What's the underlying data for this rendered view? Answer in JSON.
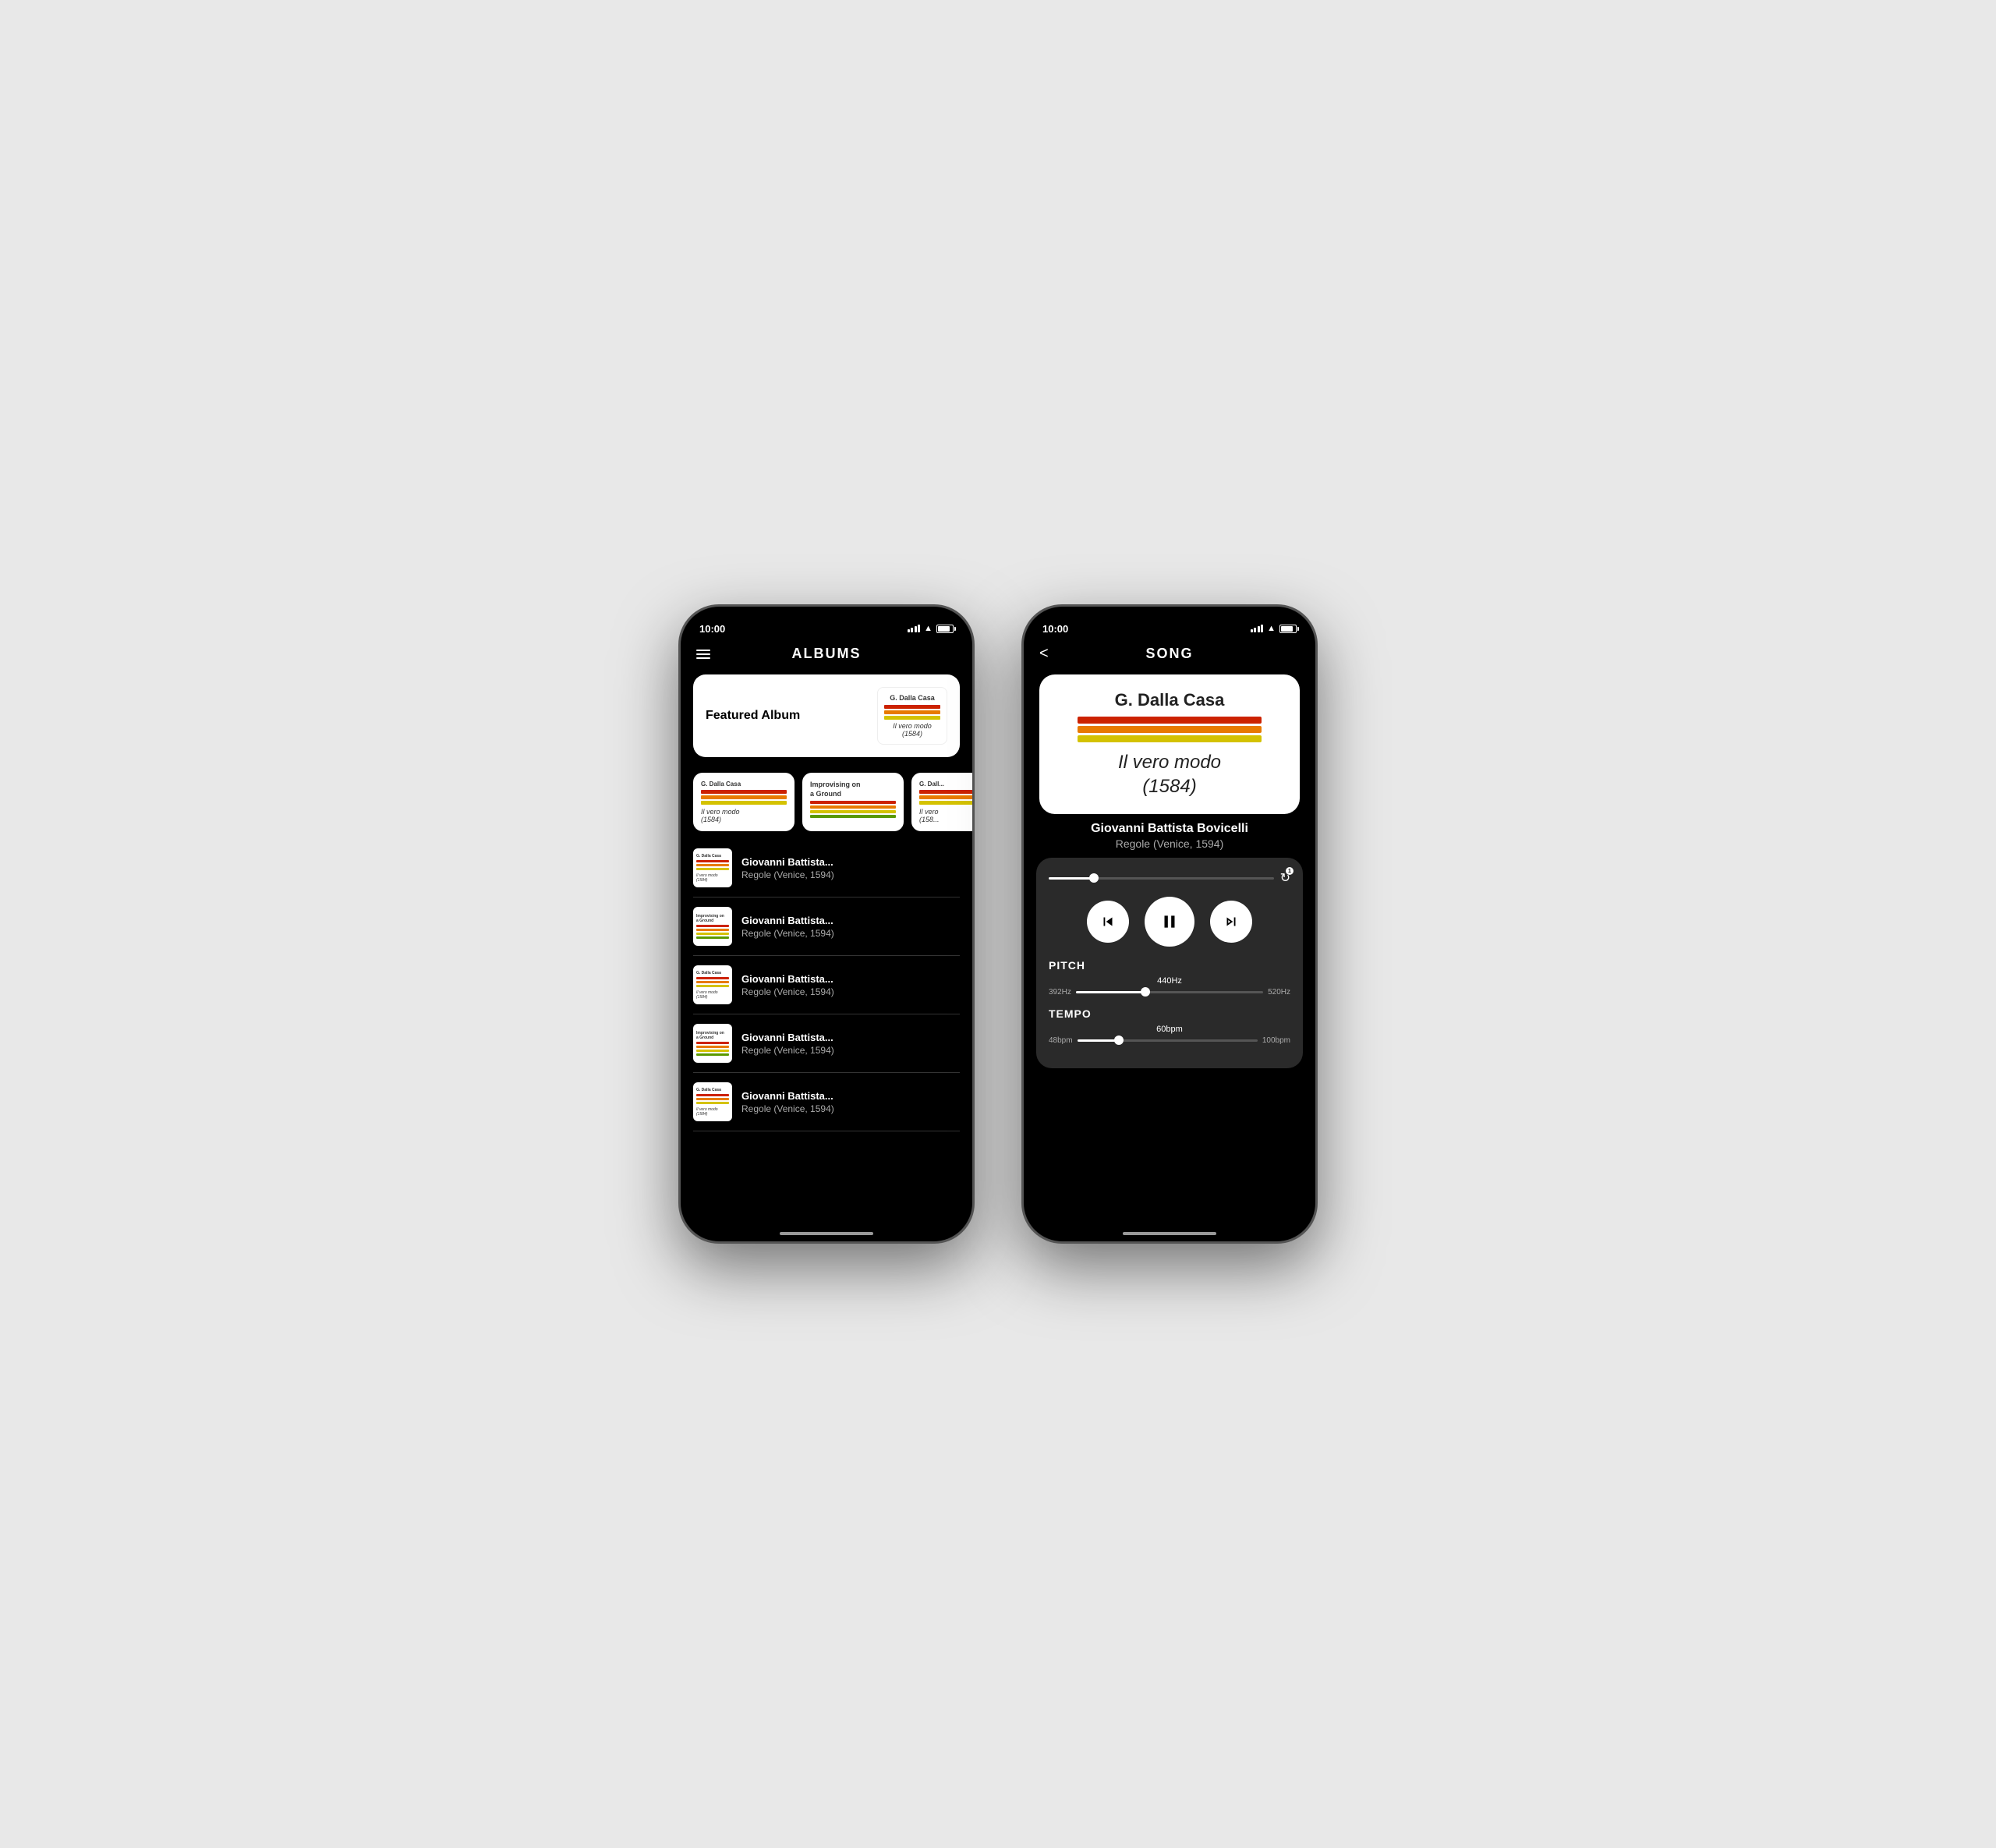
{
  "left_phone": {
    "status_bar": {
      "time": "10:00"
    },
    "nav": {
      "title": "ALBUMS"
    },
    "featured": {
      "label": "Featured Album",
      "album_author": "G. Dalla Casa",
      "album_title_italic": "Il vero modo",
      "album_year": "(1584)"
    },
    "horizontal_albums": [
      {
        "author": "G. Dalla Casa",
        "title": "Il vero modo",
        "year": "(1584)",
        "type": "dalla_casa"
      },
      {
        "author": "Improvising on\na Ground",
        "title": "",
        "year": "",
        "type": "improvising"
      },
      {
        "author": "G. Dall...",
        "title": "Il vero",
        "year": "(158...",
        "type": "dalla_casa_cropped"
      }
    ],
    "list_items": [
      {
        "artist": "Giovanni Battista Bovicelli",
        "album": "Regole (Venice, 1594)",
        "thumb_type": "dalla_casa",
        "thumb_author": "G. Dalla Casa",
        "thumb_title": "Il vero modo\n(1584)"
      },
      {
        "artist": "Giovanni Battista Bovicelli",
        "album": "Regole (Venice, 1594)",
        "thumb_type": "improvising",
        "thumb_author": "Improvising on\na Ground",
        "thumb_title": ""
      },
      {
        "artist": "Giovanni Battista Bovicelli",
        "album": "Regole (Venice, 1594)",
        "thumb_type": "dalla_casa",
        "thumb_author": "G. Dalla Casa",
        "thumb_title": "Il vero modo\n(1584)"
      },
      {
        "artist": "Giovanni Battista Bovicelli",
        "album": "Regole (Venice, 1594)",
        "thumb_type": "improvising",
        "thumb_author": "Improvising on\na Ground",
        "thumb_title": ""
      },
      {
        "artist": "Giovanni Battista Bovicelli",
        "album": "Regole (Venice, 1594)",
        "thumb_type": "dalla_casa",
        "thumb_author": "G. Dalla Casa",
        "thumb_title": "Il vero modo\n(1584)"
      }
    ]
  },
  "right_phone": {
    "status_bar": {
      "time": "10:00"
    },
    "nav": {
      "title": "SONG",
      "back_label": "<"
    },
    "artwork": {
      "author": "G. Dalla Casa",
      "title_italic": "Il vero modo",
      "year": "(1584)"
    },
    "song_info": {
      "artist": "Giovanni Battista Bovicelli",
      "album": "Regole (Venice, 1594)"
    },
    "player": {
      "progress_percent": 20,
      "repeat_count": "1"
    },
    "pitch": {
      "label": "PITCH",
      "current": "440Hz",
      "min": "392Hz",
      "max": "520Hz",
      "percent": 37
    },
    "tempo": {
      "label": "TEMPO",
      "current": "60bpm",
      "min": "48bpm",
      "max": "100bpm",
      "percent": 23
    }
  },
  "colors": {
    "stripe_red": "#cc2200",
    "stripe_orange": "#e87a00",
    "stripe_yellow": "#d4c200",
    "stripe_green": "#5a9900"
  }
}
